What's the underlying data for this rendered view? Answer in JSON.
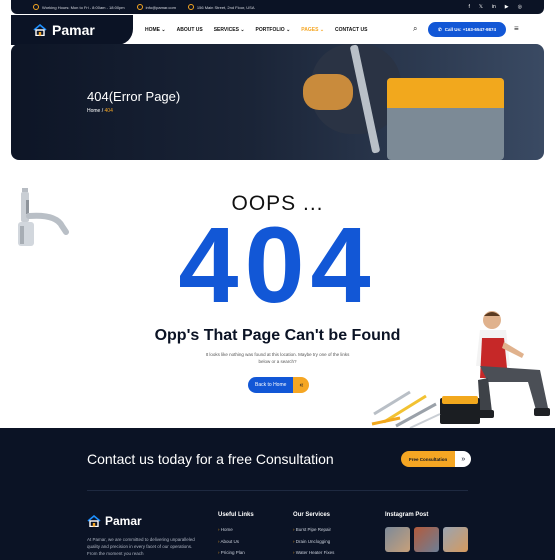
{
  "topbar": {
    "hours": "Working Hours: Mon to Fri - 8:00am - 18:00pm",
    "email": "info@pamar.com",
    "address": "156 Main Street, 2nd Floor, USA",
    "social": [
      "f",
      "𝕏",
      "in",
      "▶",
      "◎"
    ]
  },
  "header": {
    "logo": "Pamar",
    "nav": [
      {
        "label": "HOME",
        "has_dropdown": true
      },
      {
        "label": "ABOUT US",
        "has_dropdown": false
      },
      {
        "label": "SERVICES",
        "has_dropdown": true
      },
      {
        "label": "PORTFOLIO",
        "has_dropdown": true
      },
      {
        "label": "PAGES",
        "has_dropdown": true,
        "active": true
      },
      {
        "label": "CONTACT US",
        "has_dropdown": false
      }
    ],
    "call_label": "Call Us: +163-6547-9874"
  },
  "hero": {
    "title": "404(Error Page)",
    "crumb_home": "Home",
    "crumb_sep": " / ",
    "crumb_current": "404"
  },
  "error": {
    "oops": "OOPS ...",
    "code": "404",
    "heading": "Opp's That Page Can't be Found",
    "description": "It looks like nothing was found at this location. Maybe try one of the links below or a search?",
    "back_label": "Back to Home",
    "back_arrow": "«"
  },
  "footer": {
    "cta_text": "Contact us today for a free Consultation",
    "cta_button": "Free Consultation",
    "cta_arrow": "»",
    "logo": "Pamar",
    "about": "At Pamar, we are committed to delivering unparalleled quality and precision in every facet of our operations. From the moment you reach",
    "useful_links_title": "Useful Links",
    "useful_links": [
      "Home",
      "About Us",
      "Pricing Plan"
    ],
    "services_title": "Our Services",
    "services": [
      "Burst Pipe Repair",
      "Drain Unclogging",
      "Water Heater Fixes"
    ],
    "instagram_title": "Instagram Post"
  },
  "colors": {
    "brand_blue": "#1257d6",
    "accent_orange": "#f5a623",
    "dark_navy": "#0b1325"
  }
}
